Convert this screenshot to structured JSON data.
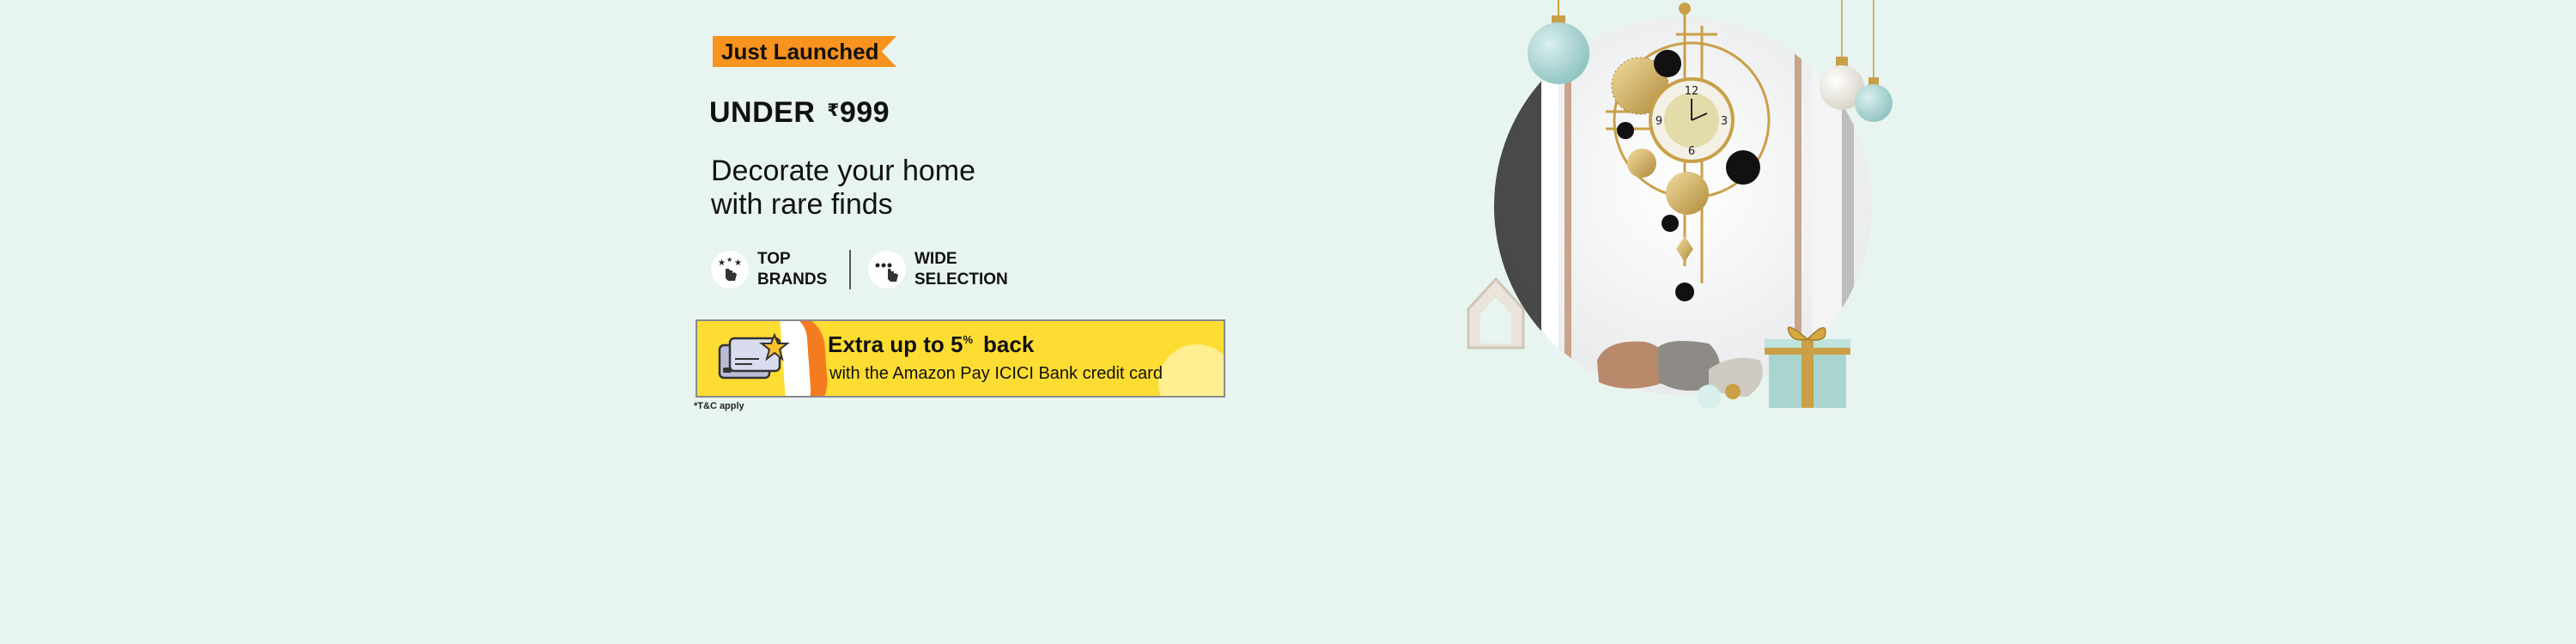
{
  "banner": {
    "tag": "Just Launched",
    "price_prefix": "UNDER",
    "currency": "₹",
    "price": "999",
    "headline_line1": "Decorate your home",
    "headline_line2": "with rare finds",
    "features": [
      {
        "icon": "sparkle-hand-icon",
        "line1": "TOP",
        "line2": "BRANDS"
      },
      {
        "icon": "pointer-hand-icon",
        "line1": "WIDE",
        "line2": "SELECTION"
      }
    ],
    "offer": {
      "main": "Extra up to 5",
      "superscript": "%",
      "main_suffix": "back",
      "sub": "with the Amazon Pay ICICI Bank credit card",
      "icon": "credit-card-star-icon"
    },
    "tnc": "*T&C apply",
    "clock_numbers": [
      "12",
      "3",
      "6",
      "9"
    ]
  },
  "colors": {
    "background": "#e8f4f0",
    "tag": "#f7931e",
    "offer_bg": "#fedd33",
    "offer_stripe": "#f47b20"
  }
}
